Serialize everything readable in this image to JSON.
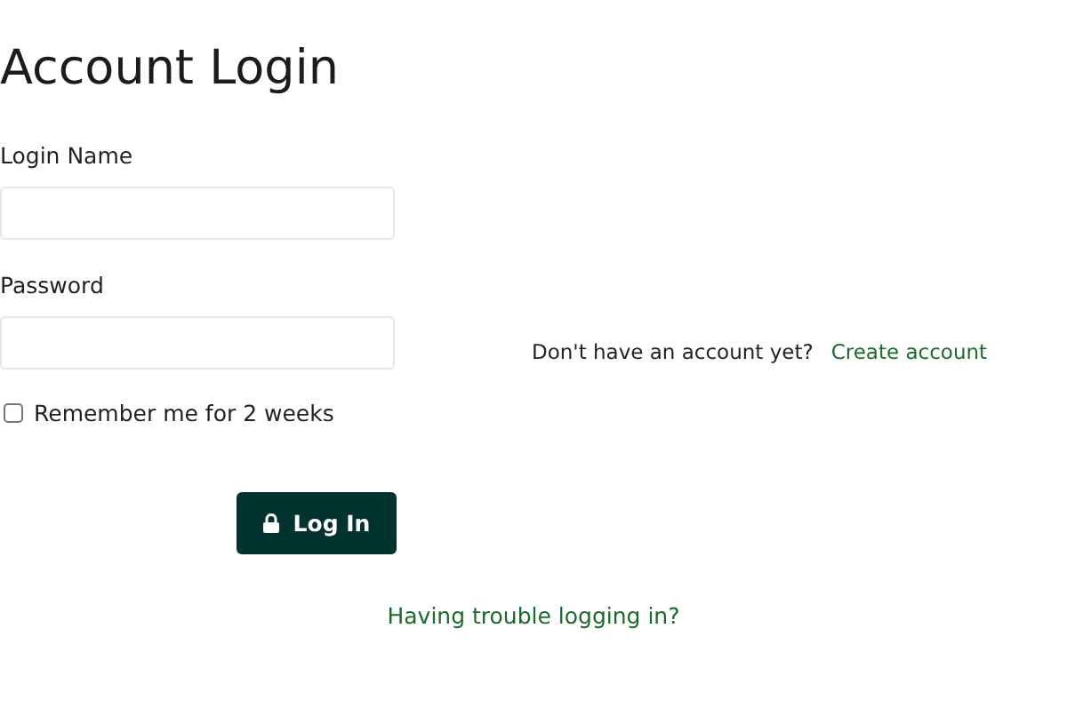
{
  "title": "Account Login",
  "login_name": {
    "label": "Login Name"
  },
  "password": {
    "label": "Password"
  },
  "signup": {
    "prompt": "Don't have an account yet?",
    "link": "Create account"
  },
  "remember": {
    "label": "Remember me for 2 weeks",
    "checked": false
  },
  "login_button": {
    "label": "Log In"
  },
  "trouble_link": "Having trouble logging in?"
}
